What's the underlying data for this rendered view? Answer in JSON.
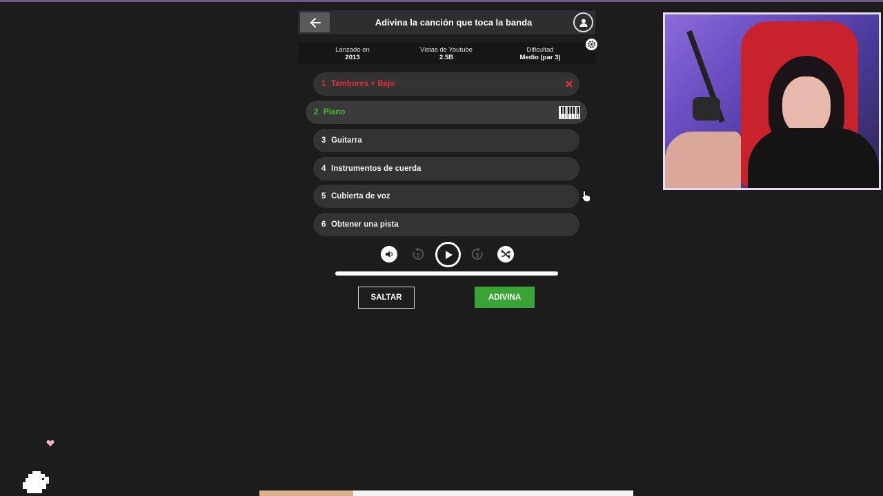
{
  "header": {
    "title": "Adivina la canción que toca la banda",
    "back_icon": "arrow-left-icon",
    "profile_icon": "user-icon"
  },
  "info": [
    {
      "label": "Lanzado en",
      "value": "2013"
    },
    {
      "label": "Vistas de Youtube",
      "value": "2.5B"
    },
    {
      "label": "Dificultad",
      "value": "Medio (par 3)"
    }
  ],
  "stems": [
    {
      "num": "1",
      "label": "Tambores + Bajo",
      "state": "failed"
    },
    {
      "num": "2",
      "label": "Piano",
      "state": "active"
    },
    {
      "num": "3",
      "label": "Guitarra",
      "state": "locked"
    },
    {
      "num": "4",
      "label": "Instrumentos de cuerda",
      "state": "locked"
    },
    {
      "num": "5",
      "label": "Cubierta de voz",
      "state": "locked"
    },
    {
      "num": "6",
      "label": "Obtener una pista",
      "state": "locked"
    }
  ],
  "player": {
    "progress": 1.0,
    "controls": [
      "volume-icon",
      "rewind-5-icon",
      "play-icon",
      "forward-5-icon",
      "shuffle-disabled-icon"
    ]
  },
  "actions": {
    "skip_label": "SALTAR",
    "guess_label": "ADIVINA"
  },
  "colors": {
    "failed": "#e0303a",
    "active": "#46b83e",
    "guess_button": "#3aa335",
    "background": "#1c1c1c"
  }
}
